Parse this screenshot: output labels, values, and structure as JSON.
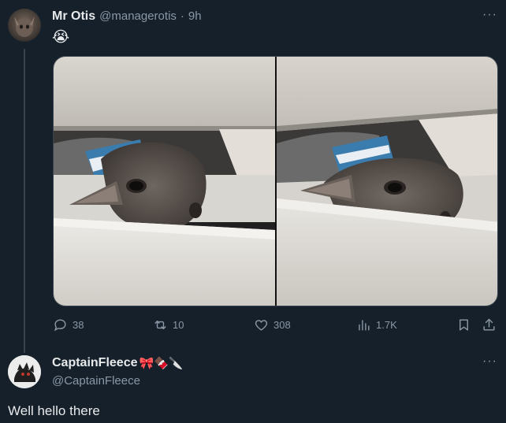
{
  "tweet": {
    "author_name": "Mr Otis",
    "author_handle": "@managerotis",
    "separator": "·",
    "time": "9h",
    "text": "😭",
    "more_icon": "more-dots-icon",
    "actions": {
      "replies": "38",
      "retweets": "10",
      "likes": "308",
      "views": "1.7K"
    }
  },
  "reply": {
    "author_name": "CaptainFleece",
    "author_emojis": "🎀🍫🔪",
    "author_handle": "@CaptainFleece",
    "text": "Well hello there"
  },
  "colors": {
    "background": "#15202b",
    "text_primary": "#e7e9ea",
    "text_secondary": "#8b98a5",
    "divider": "#38444d"
  }
}
